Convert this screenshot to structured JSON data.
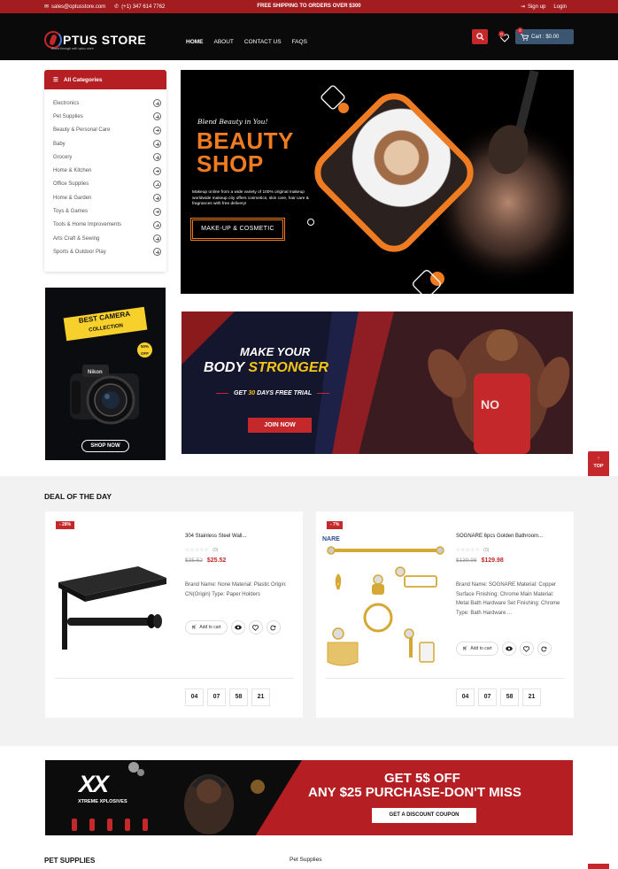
{
  "topbar": {
    "email": "sales@optusstore.com",
    "phone": "(+1) 347 614 7762",
    "shipping_text": "FREE SHIPPING TO ORDERS OVER ",
    "shipping_amount": "$300",
    "signup": "Sign up",
    "login": "Login"
  },
  "header": {
    "logo_text": "PTUS STORE",
    "logo_tagline": "Brand through with optus store",
    "nav": [
      "HOME",
      "ABOUT",
      "CONTACT US",
      "FAQS"
    ],
    "wishlist_count": "0",
    "cart_count": "0",
    "cart_label": "Cart : $0.00"
  },
  "categories": {
    "heading": "All Categories",
    "items": [
      "Electronics",
      "Pet Supplies",
      "Beauty & Personal Care",
      "Baby",
      "Grocery",
      "Home & Kitchen",
      "Office Supplies",
      "Home & Garden",
      "Toys & Games",
      "Tools & Home Improvements",
      "Arts Craft & Sewing",
      "Sports & Outdoor Play"
    ]
  },
  "camera_ad": {
    "line1": "BEST CAMERA",
    "line2": "COLLECTION",
    "sale": "50% OFF",
    "cta": "SHOP NOW"
  },
  "hero": {
    "script": "Blend Beauty in You!",
    "title_line1": "BEAUTY",
    "title_line2": "SHOP",
    "description": "Makeup online from a wide variety of 100% original makeup worldwide makeup city offers cosmetics, skin care, hair care & fragrances with free delivery!",
    "cta": "MAKE-UP & COSMETIC"
  },
  "fitness": {
    "line1": "MAKE YOUR",
    "line2a": "BODY ",
    "line2b": "STRONGER",
    "line3a": "GET ",
    "line3b": "30",
    "line3c": " DAYS FREE TRIAL",
    "cta": "JOIN NOW"
  },
  "top_button": "TOP",
  "deal": {
    "title": "DEAL OF THE DAY",
    "products": [
      {
        "discount": "- 28%",
        "name": "304 Stainless Steel Wall...",
        "rating_count": "(0)",
        "old_price": "$35.52",
        "new_price": "$25.52",
        "description": "Brand Name: None Material: Plastic Origin: CN(Origin) Type: Paper Holders",
        "add_to_cart": "Add to cart",
        "timer": [
          "04",
          "07",
          "58",
          "21"
        ]
      },
      {
        "discount": "- 7%",
        "name": "SOGNARE 6pcs Golden Bathroom...",
        "rating_count": "(0)",
        "old_price": "$139.98",
        "new_price": "$129.98",
        "description": "Brand Name: SOGNARE Material: Copper Surface Finishing: Chrome Main Material: Metal Bath Hardware Set Finishing: Chrome Type: Bath Hardware ...",
        "add_to_cart": "Add to cart",
        "brand_tag": "NARE",
        "timer": [
          "04",
          "07",
          "58",
          "21"
        ]
      }
    ]
  },
  "promo": {
    "brand": "XX",
    "brand_sub": "XTREME XPLOSIVES",
    "line1": "GET 5$ OFF",
    "line2": "ANY $25 PURCHASE-DON'T MISS",
    "cta": "GET A DISCOUNT COUPON"
  },
  "pet_section": {
    "title": "PET SUPPLIES",
    "subtitle": "Pet Supplies"
  }
}
